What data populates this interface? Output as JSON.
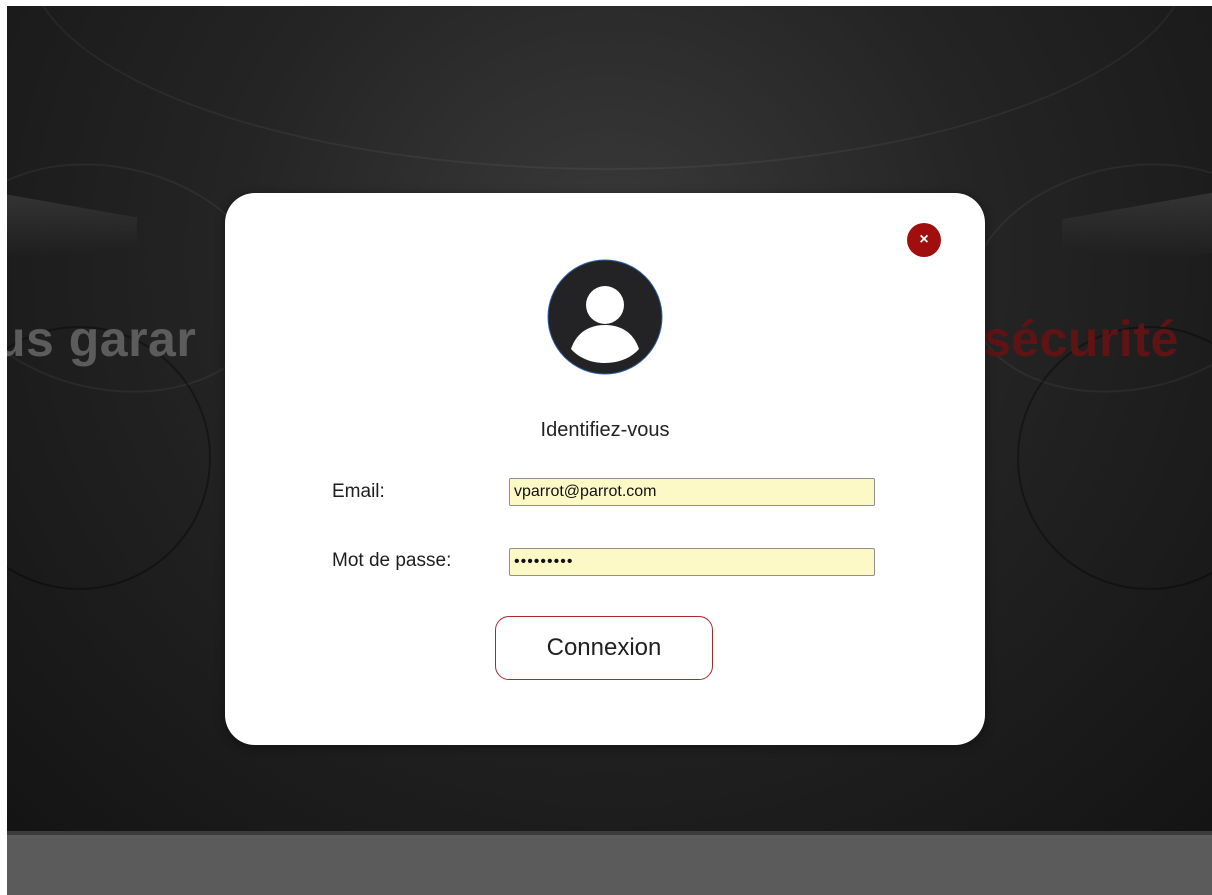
{
  "hero": {
    "headline_left": "us garar",
    "headline_right": "sécurité"
  },
  "modal": {
    "close_glyph": "×",
    "title": "Identifiez-vous",
    "email_label": "Email:",
    "email_value": "vparrot@parrot.com",
    "password_label": "Mot de passe:",
    "password_value": "passwordx",
    "submit_label": "Connexion"
  },
  "icons": {
    "close": "close-icon",
    "avatar": "user-avatar-icon"
  },
  "colors": {
    "accent_red": "#a10e0e",
    "button_border": "#b0262b",
    "autofill_bg": "#fdf9c7",
    "avatar_dark": "#232326"
  }
}
